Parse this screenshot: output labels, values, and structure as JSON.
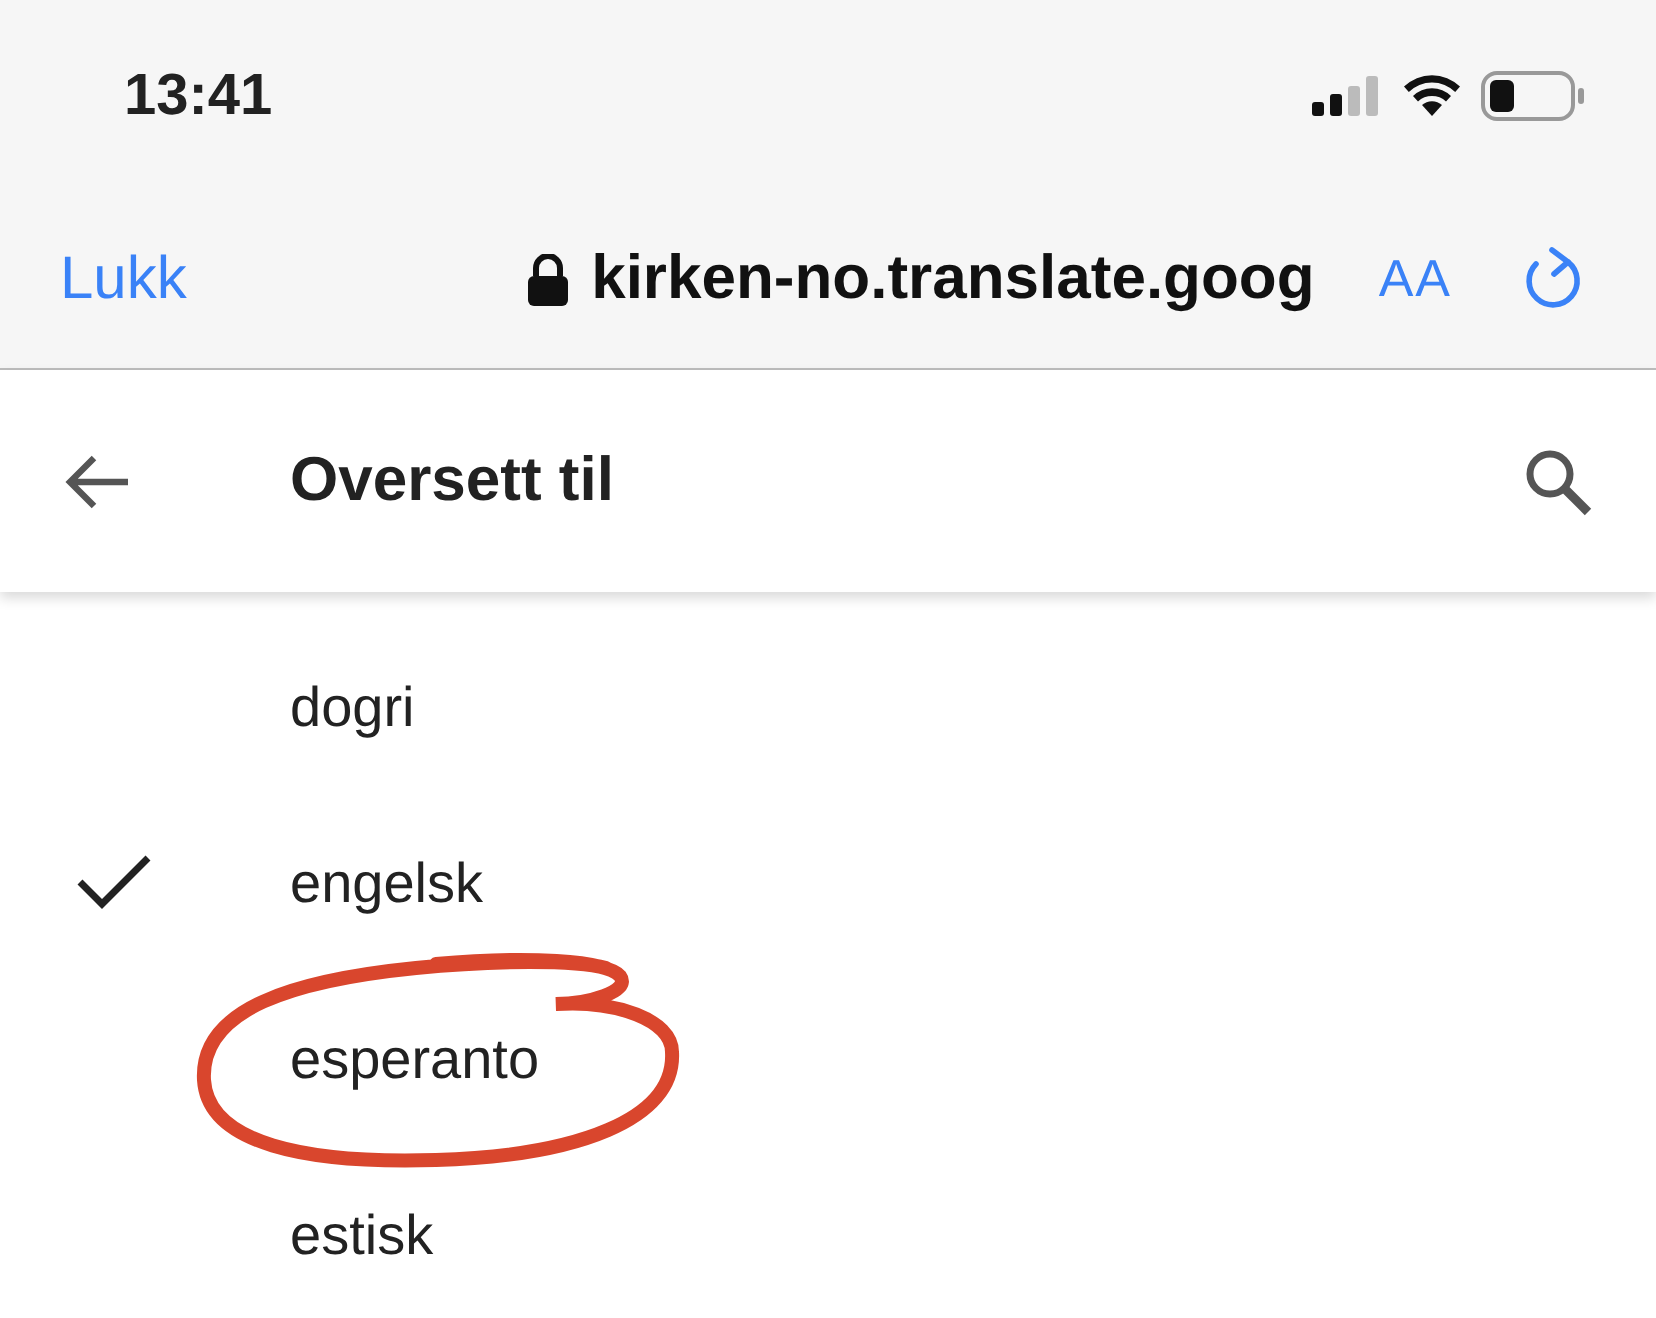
{
  "status_bar": {
    "time": "13:41"
  },
  "browser_bar": {
    "close": "Lukk",
    "url": "kirken-no.translate.goog",
    "text_size": "AA"
  },
  "app_bar": {
    "title": "Oversett til"
  },
  "languages": [
    {
      "label": "dogri",
      "selected": false,
      "circled": false
    },
    {
      "label": "engelsk",
      "selected": true,
      "circled": false
    },
    {
      "label": "esperanto",
      "selected": false,
      "circled": true
    },
    {
      "label": "estisk",
      "selected": false,
      "circled": false
    }
  ]
}
